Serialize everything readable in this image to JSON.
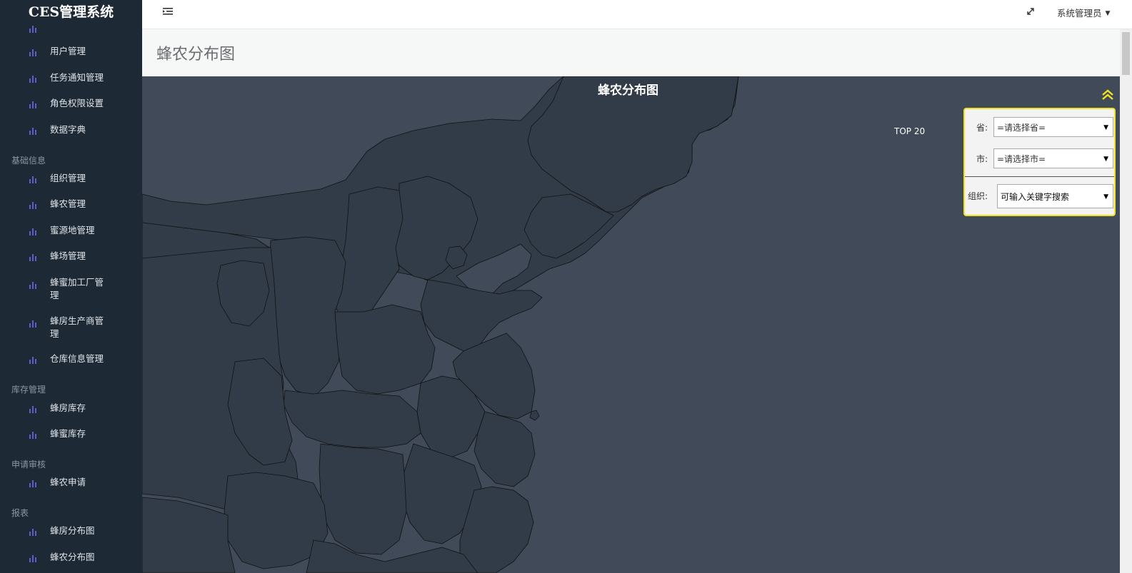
{
  "app": {
    "brand": "CES管理系统"
  },
  "header": {
    "user_name": "系统管理员"
  },
  "page": {
    "title": "蜂农分布图"
  },
  "sidebar": {
    "items_top": [
      {
        "label": "用户管理"
      },
      {
        "label": "任务通知管理"
      },
      {
        "label": "角色权限设置"
      },
      {
        "label": "数据字典"
      }
    ],
    "section_basic": "基础信息",
    "items_basic": [
      {
        "label": "组织管理"
      },
      {
        "label": "蜂农管理"
      },
      {
        "label": "蜜源地管理"
      },
      {
        "label": "蜂场管理"
      },
      {
        "label": "蜂蜜加工厂管理"
      },
      {
        "label": "蜂房生产商管理"
      },
      {
        "label": "仓库信息管理"
      }
    ],
    "section_stock": "库存管理",
    "items_stock": [
      {
        "label": "蜂房库存"
      },
      {
        "label": "蜂蜜库存"
      }
    ],
    "section_review": "申请审核",
    "items_review": [
      {
        "label": "蜂农申请"
      }
    ],
    "section_report": "报表",
    "items_report": [
      {
        "label": "蜂房分布图"
      },
      {
        "label": "蜂农分布图"
      }
    ]
  },
  "map": {
    "title": "蜂农分布图",
    "top_label": "TOP 20",
    "background_color": "#404a59",
    "land_color": "#323c48",
    "border_color": "#111111"
  },
  "filters": {
    "province_label": "省:",
    "province_value": "=请选择省=",
    "city_label": "市:",
    "city_value": "=请选择市=",
    "org_label": "组织:",
    "org_placeholder": "可输入关键字搜索"
  },
  "colors": {
    "sidebar_bg": "#1d2a36",
    "menu_icon": "#5b5fc7",
    "panel_border": "#f1e21e"
  }
}
